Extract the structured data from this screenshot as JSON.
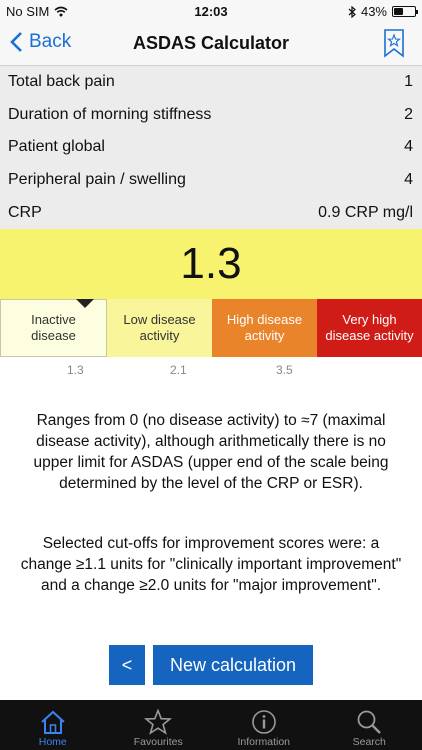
{
  "status": {
    "carrier": "No SIM",
    "time": "12:03",
    "battery": "43%",
    "battery_level": 0.43
  },
  "nav": {
    "back_label": "Back",
    "title": "ASDAS Calculator"
  },
  "inputs": [
    {
      "label": "Total back pain",
      "value": "1"
    },
    {
      "label": "Duration of morning stiffness",
      "value": "2"
    },
    {
      "label": "Patient global",
      "value": "4"
    },
    {
      "label": "Peripheral pain / swelling",
      "value": "4"
    },
    {
      "label": "CRP",
      "value": "0.9 CRP mg/l"
    }
  ],
  "result": "1.3",
  "scale": {
    "categories": [
      "Inactive disease",
      "Low disease activity",
      "High disease activity",
      "Very high disease activity"
    ],
    "cutoffs": [
      "1.3",
      "2.1",
      "3.5"
    ]
  },
  "description": [
    "Ranges from 0 (no disease activity) to ≈7 (maximal disease activity), although arithmetically there is no upper limit for ASDAS (upper end of the scale being determined by the level of the CRP or ESR).",
    "Selected cut-offs for improvement scores were: a change ≥1.1 units for \"clinically important improvement\" and a change ≥2.0 units for \"major improvement\"."
  ],
  "buttons": {
    "back_label": "<",
    "new_label": "New calculation"
  },
  "tabs": [
    {
      "label": "Home",
      "icon": "home-icon"
    },
    {
      "label": "Favourites",
      "icon": "star-icon"
    },
    {
      "label": "Information",
      "icon": "info-icon"
    },
    {
      "label": "Search",
      "icon": "search-icon"
    }
  ],
  "colors": {
    "accent": "#1565c0",
    "result_bg": "#f8f36e",
    "high": "#e9842b",
    "very_high": "#d01c17"
  }
}
